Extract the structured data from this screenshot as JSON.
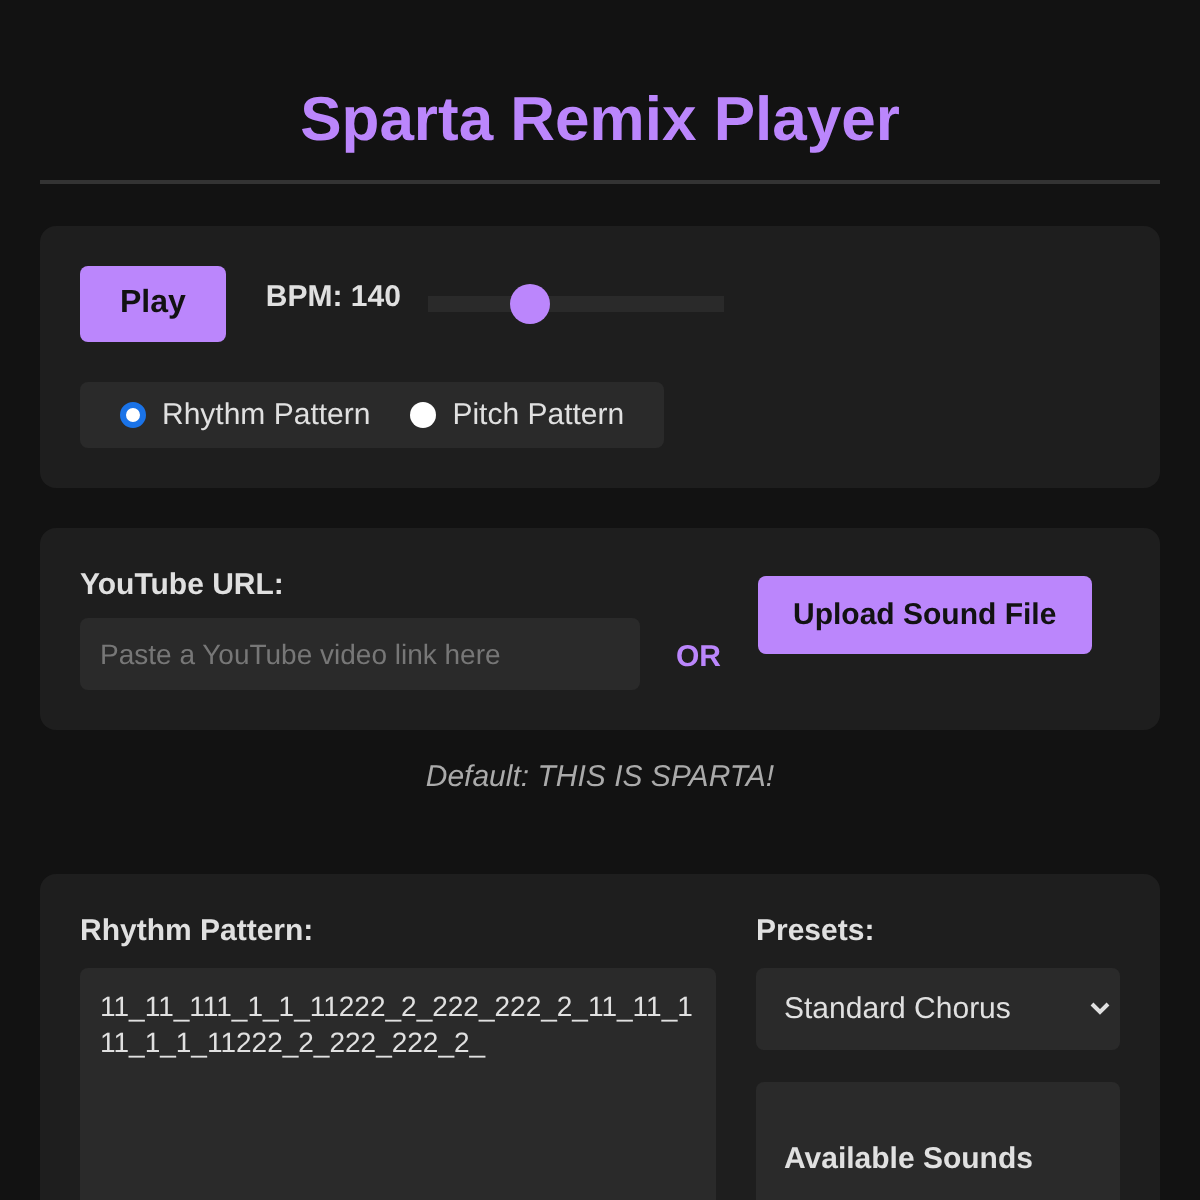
{
  "title": "Sparta Remix Player",
  "controls": {
    "play_button": "Play",
    "bpm_label": "BPM: 140",
    "bpm_slider": {
      "level": 0.34
    },
    "modes": [
      {
        "label": "Rhythm Pattern",
        "selected": true
      },
      {
        "label": "Pitch Pattern",
        "selected": false
      }
    ]
  },
  "source": {
    "url_label": "YouTube URL:",
    "url_field": {
      "placeholder": "Paste a YouTube video link here"
    },
    "or_label": "OR",
    "upload_button": "Upload Sound File"
  },
  "default_note": "Default: THIS IS SPARTA!",
  "pattern": {
    "label": "Rhythm Pattern:",
    "value": "11_11_111_1_1_11222_2_222_222_2_11_11_111_1_1_11222_2_222_222_2_",
    "presets_label": "Presets:",
    "preset_selected": "Standard Chorus",
    "sounds_heading": "Available Sounds"
  }
}
